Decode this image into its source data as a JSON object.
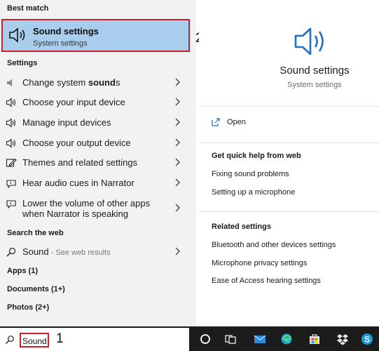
{
  "left": {
    "best_match_label": "Best match",
    "best_match": {
      "title": "Sound settings",
      "subtitle": "System settings",
      "callout": "2"
    },
    "settings_label": "Settings",
    "settings_items": [
      {
        "label_pre": "Change system ",
        "label_bold": "sound",
        "label_post": "s",
        "icon": "speaker-small-icon"
      },
      {
        "label": "Choose your input device",
        "icon": "speaker-icon"
      },
      {
        "label": "Manage input devices",
        "icon": "speaker-icon"
      },
      {
        "label": "Choose your output device",
        "icon": "speaker-icon"
      },
      {
        "label": "Themes and related settings",
        "icon": "pencil-icon"
      },
      {
        "label": "Hear audio cues in Narrator",
        "icon": "narrator-icon"
      },
      {
        "label_line1": "Lower the volume of other apps",
        "label_line2": "when Narrator is speaking",
        "icon": "narrator-icon"
      }
    ],
    "search_web_label": "Search the web",
    "web_result": {
      "label": "Sound",
      "suffix": " - See web results"
    },
    "categories": [
      "Apps (1)",
      "Documents (1+)",
      "Photos (2+)"
    ]
  },
  "right": {
    "title": "Sound settings",
    "subtitle": "System settings",
    "open_label": "Open",
    "quick_help_label": "Get quick help from web",
    "quick_help_links": [
      "Fixing sound problems",
      "Setting up a microphone"
    ],
    "related_label": "Related settings",
    "related_links": [
      "Bluetooth and other devices settings",
      "Microphone privacy settings",
      "Ease of Access hearing settings"
    ]
  },
  "taskbar": {
    "search_value": "Sound",
    "callout": "1",
    "icons": [
      "cortana-icon",
      "task-view-icon",
      "mail-icon",
      "edge-icon",
      "store-icon",
      "dropbox-icon",
      "skype-icon"
    ]
  },
  "colors": {
    "selected": "#a9cdec",
    "highlight_border": "#c8202e",
    "icon_blue": "#1f6fc0",
    "taskbar": "#1c1c1c"
  }
}
